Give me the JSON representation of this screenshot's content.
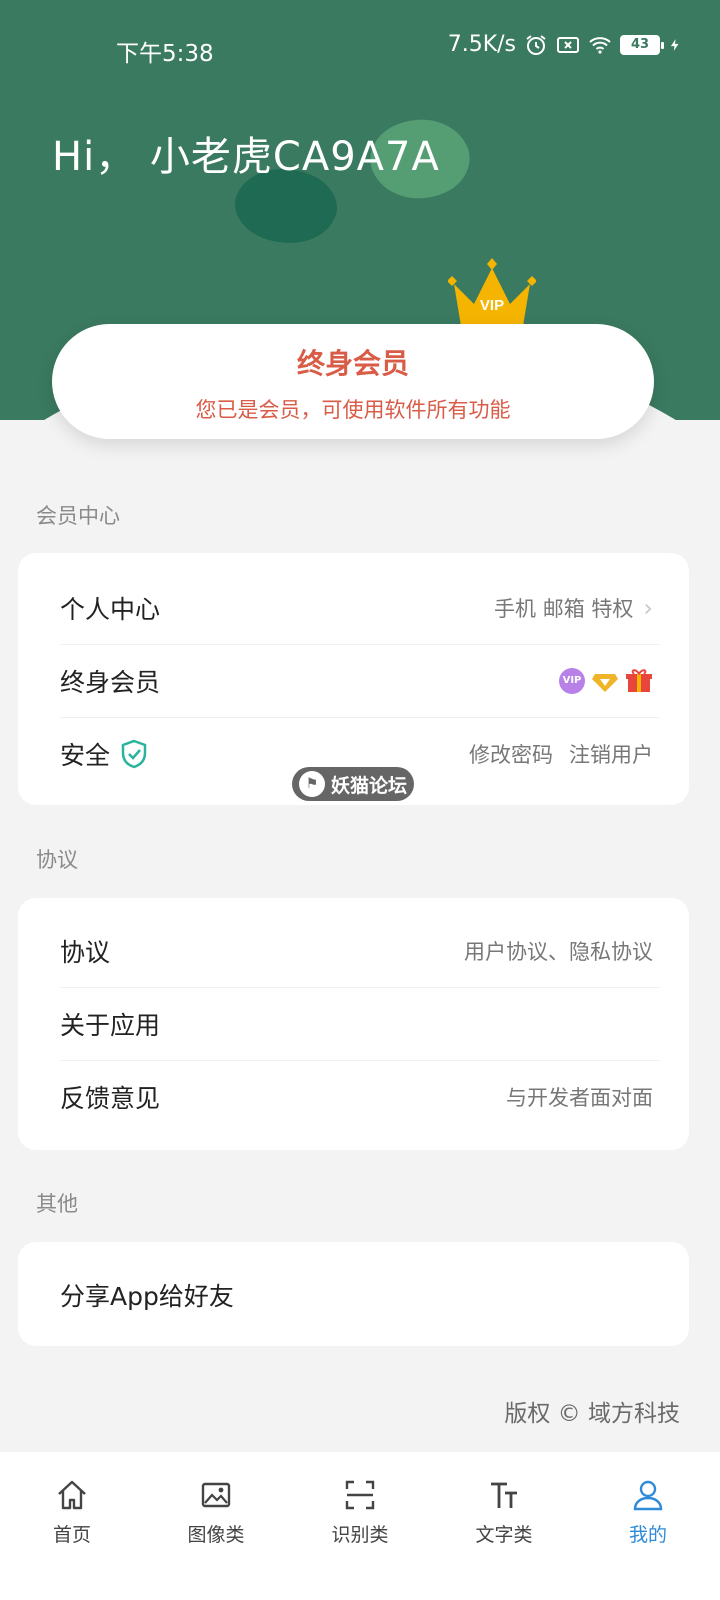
{
  "status_bar": {
    "time": "下午5:38",
    "network_speed": "7.5K/s",
    "battery": "43"
  },
  "header": {
    "greeting": "Hi， 小老虎CA9A7A"
  },
  "member_card": {
    "title": "终身会员",
    "subtitle": "您已是会员，可使用软件所有功能",
    "crown_label": "VIP"
  },
  "sections": {
    "member_center": {
      "label": "会员中心",
      "rows": [
        {
          "label": "个人中心",
          "right": "手机 邮箱 特权"
        },
        {
          "label": "终身会员",
          "right": ""
        },
        {
          "label": "安全",
          "right_a": "修改密码",
          "right_b": "注销用户"
        }
      ],
      "vip_badge": "VIP"
    },
    "agreement": {
      "label": "协议",
      "rows": [
        {
          "label": "协议",
          "right": "用户协议、隐私协议"
        },
        {
          "label": "关于应用",
          "right": ""
        },
        {
          "label": "反馈意见",
          "right": "与开发者面对面"
        }
      ]
    },
    "other": {
      "label": "其他",
      "rows": [
        {
          "label": "分享App给好友"
        }
      ]
    }
  },
  "watermark": "妖猫论坛",
  "copyright": "版权 © 域方科技",
  "bottom_nav": [
    {
      "label": "首页",
      "icon": "home-icon"
    },
    {
      "label": "图像类",
      "icon": "image-icon"
    },
    {
      "label": "识别类",
      "icon": "scan-icon"
    },
    {
      "label": "文字类",
      "icon": "text-icon"
    },
    {
      "label": "我的",
      "icon": "user-icon",
      "active": true
    }
  ],
  "colors": {
    "header_green": "#3a7a60",
    "member_red": "#d95c47",
    "active_blue": "#2f8bd8"
  }
}
